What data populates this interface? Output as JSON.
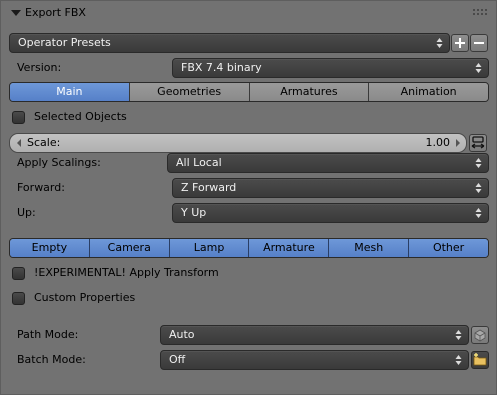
{
  "header": {
    "title": "Export FBX"
  },
  "presets": {
    "label": "Operator Presets"
  },
  "version": {
    "label": "Version:",
    "value": "FBX 7.4 binary"
  },
  "tabs": [
    "Main",
    "Geometries",
    "Armatures",
    "Animation"
  ],
  "selected_objects": {
    "label": "Selected Objects",
    "checked": false
  },
  "scale": {
    "label": "Scale:",
    "value": "1.00"
  },
  "apply_scalings": {
    "label": "Apply Scalings:",
    "value": "All Local"
  },
  "forward": {
    "label": "Forward:",
    "value": "Z Forward"
  },
  "up": {
    "label": "Up:",
    "value": "Y Up"
  },
  "object_types": [
    "Empty",
    "Camera",
    "Lamp",
    "Armature",
    "Mesh",
    "Other"
  ],
  "experimental": {
    "label": "!EXPERIMENTAL! Apply Transform",
    "checked": false
  },
  "custom_properties": {
    "label": "Custom Properties",
    "checked": false
  },
  "path_mode": {
    "label": "Path Mode:",
    "value": "Auto"
  },
  "batch_mode": {
    "label": "Batch Mode:",
    "value": "Off"
  },
  "colors": {
    "accent": "#5680c8",
    "panel": "#727272",
    "field": "#3a3a3a"
  }
}
